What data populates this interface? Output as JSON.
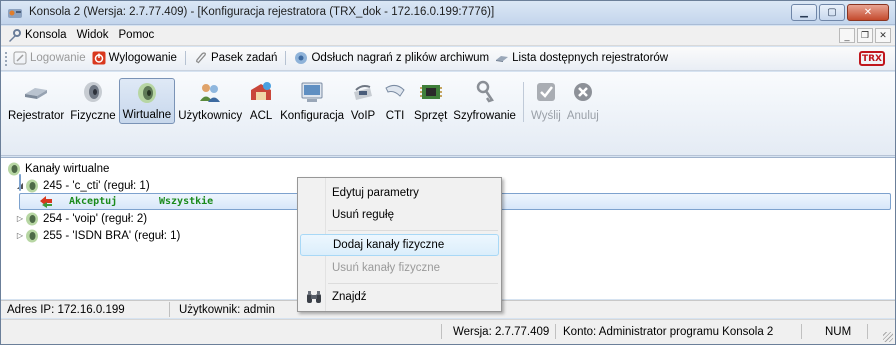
{
  "window": {
    "title": "Konsola 2 (Wersja: 2.7.77.409) - [Konfiguracja rejestratora (TRX_dok - 172.16.0.199:7776)]",
    "caption_buttons": [
      "minimize",
      "maximize",
      "close"
    ]
  },
  "menubar": {
    "items": [
      "Konsola",
      "Widok",
      "Pomoc"
    ],
    "mdi_buttons": [
      "_",
      "restore",
      "x"
    ]
  },
  "taskbar": {
    "items": [
      {
        "label": "Logowanie",
        "icon": "login-icon",
        "disabled": true
      },
      {
        "label": "Wylogowanie",
        "icon": "logout-icon",
        "disabled": false
      },
      {
        "label": "Pasek zadań",
        "icon": "paperclip-icon",
        "disabled": false
      },
      {
        "label": "Odsłuch nagrań z plików archiwum",
        "icon": "archive-play-icon",
        "disabled": false
      },
      {
        "label": "Lista dostępnych rejestratorów",
        "icon": "recorders-list-icon",
        "disabled": false
      }
    ],
    "logo": "TRX"
  },
  "toolbar": {
    "tools": [
      {
        "label": "Rejestrator",
        "icon": "recorder-icon",
        "active": false,
        "disabled": false
      },
      {
        "label": "Fizyczne",
        "icon": "speaker-icon",
        "active": false,
        "disabled": false
      },
      {
        "label": "Wirtualne",
        "icon": "virtual-speaker-icon",
        "active": true,
        "disabled": false
      },
      {
        "label": "Użytkownicy",
        "icon": "users-icon",
        "active": false,
        "disabled": false
      },
      {
        "label": "ACL",
        "icon": "acl-icon",
        "active": false,
        "disabled": false
      },
      {
        "label": "Konfiguracja",
        "icon": "configuration-icon",
        "active": false,
        "disabled": false
      },
      {
        "label": "VoIP",
        "icon": "voip-icon",
        "active": false,
        "disabled": false
      },
      {
        "label": "CTI",
        "icon": "cti-icon",
        "active": false,
        "disabled": false
      },
      {
        "label": "Sprzęt",
        "icon": "hardware-icon",
        "active": false,
        "disabled": false
      },
      {
        "label": "Szyfrowanie",
        "icon": "encryption-icon",
        "active": false,
        "disabled": false
      },
      {
        "label": "Wyślij",
        "icon": "send-icon",
        "active": false,
        "disabled": true
      },
      {
        "label": "Anuluj",
        "icon": "cancel-icon",
        "active": false,
        "disabled": true
      }
    ]
  },
  "tree": {
    "root": "Kanały wirtualne",
    "channels": [
      {
        "label": "245 - 'c_cti' (reguł: 1)",
        "expanded": true
      },
      {
        "label": "254 - 'voip' (reguł: 2)",
        "expanded": false
      },
      {
        "label": "255 - 'ISDN BRA' (reguł: 1)",
        "expanded": false
      }
    ],
    "rule": {
      "action": "Akceptuj",
      "scope": "Wszystkie"
    }
  },
  "context_menu": {
    "items": [
      {
        "label": "Edytuj parametry",
        "disabled": false
      },
      {
        "label": "Usuń regułę",
        "disabled": false
      },
      {
        "label": "Dodaj kanały fizyczne",
        "disabled": false
      },
      {
        "label": "Usuń kanały fizyczne",
        "disabled": true
      },
      {
        "label": "Znajdź",
        "disabled": false
      }
    ]
  },
  "status": {
    "ip": "Adres IP: 172.16.0.199",
    "user": "Użytkownik: admin",
    "version": "Wersja: 2.7.77.409",
    "account": "Konto: Administrator programu Konsola 2",
    "num": "NUM"
  },
  "colors": {
    "rule_green": "#1a8a1a",
    "logout_red": "#d9381e",
    "brand_red": "#c0161d",
    "selection": "#d7e7fa"
  }
}
